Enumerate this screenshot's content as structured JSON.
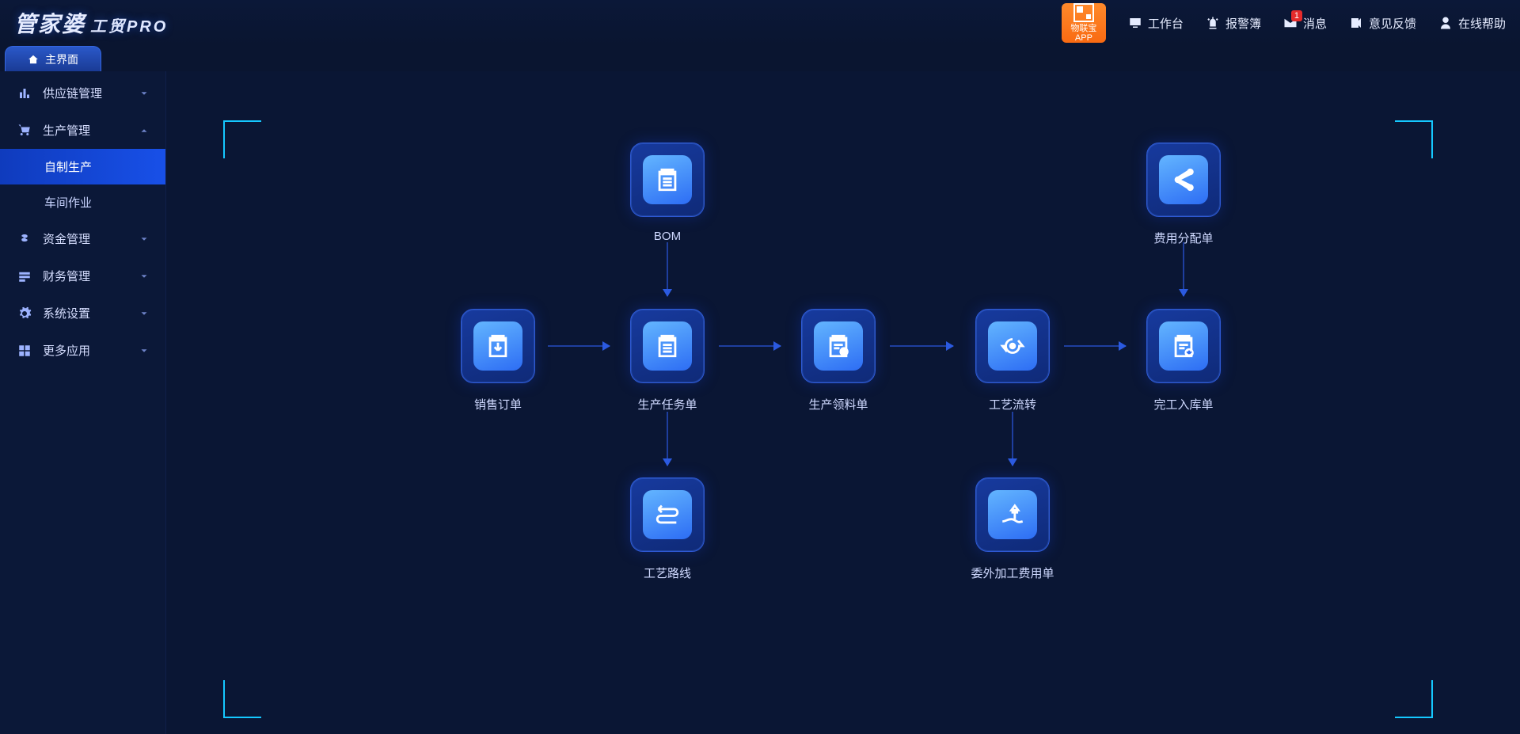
{
  "brand": {
    "name": "管家婆",
    "suffix": "工贸PRO"
  },
  "wlb": {
    "line1": "物联宝",
    "line2": "APP"
  },
  "topnav": {
    "workbench": "工作台",
    "alarm": "报警簿",
    "message": "消息",
    "message_badge": "1",
    "feedback": "意见反馈",
    "help": "在线帮助"
  },
  "tab": {
    "label": "主界面"
  },
  "sidebar": {
    "items": [
      {
        "label": "供应链管理"
      },
      {
        "label": "生产管理"
      },
      {
        "label": "资金管理"
      },
      {
        "label": "财务管理"
      },
      {
        "label": "系统设置"
      },
      {
        "label": "更多应用"
      }
    ],
    "prod_sub": [
      {
        "label": "自制生产"
      },
      {
        "label": "车间作业"
      }
    ]
  },
  "nodes": {
    "bom": {
      "label": "BOM"
    },
    "sales": {
      "label": "销售订单"
    },
    "task": {
      "label": "生产任务单"
    },
    "mat": {
      "label": "生产领料单"
    },
    "proc": {
      "label": "工艺流转"
    },
    "fin": {
      "label": "完工入库单"
    },
    "route": {
      "label": "工艺路线"
    },
    "out": {
      "label": "委外加工费用单"
    },
    "fee": {
      "label": "费用分配单"
    }
  }
}
